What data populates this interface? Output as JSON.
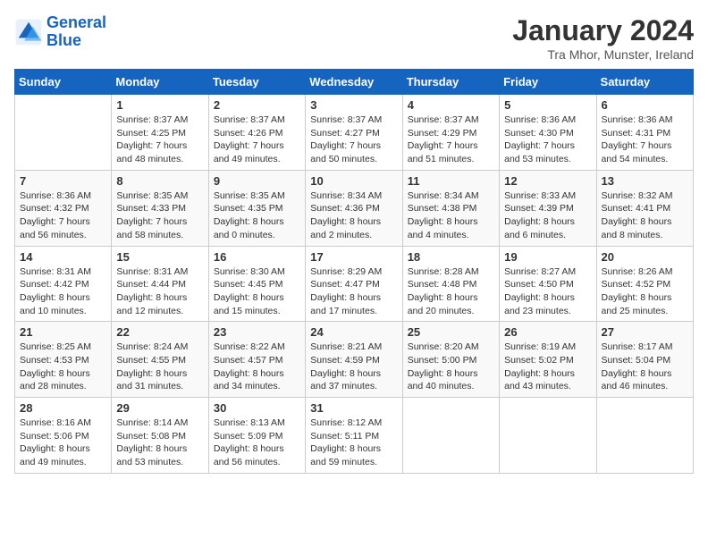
{
  "header": {
    "logo_line1": "General",
    "logo_line2": "Blue",
    "title": "January 2024",
    "subtitle": "Tra Mhor, Munster, Ireland"
  },
  "days_of_week": [
    "Sunday",
    "Monday",
    "Tuesday",
    "Wednesday",
    "Thursday",
    "Friday",
    "Saturday"
  ],
  "weeks": [
    [
      {
        "day": "",
        "info": ""
      },
      {
        "day": "1",
        "info": "Sunrise: 8:37 AM\nSunset: 4:25 PM\nDaylight: 7 hours\nand 48 minutes."
      },
      {
        "day": "2",
        "info": "Sunrise: 8:37 AM\nSunset: 4:26 PM\nDaylight: 7 hours\nand 49 minutes."
      },
      {
        "day": "3",
        "info": "Sunrise: 8:37 AM\nSunset: 4:27 PM\nDaylight: 7 hours\nand 50 minutes."
      },
      {
        "day": "4",
        "info": "Sunrise: 8:37 AM\nSunset: 4:29 PM\nDaylight: 7 hours\nand 51 minutes."
      },
      {
        "day": "5",
        "info": "Sunrise: 8:36 AM\nSunset: 4:30 PM\nDaylight: 7 hours\nand 53 minutes."
      },
      {
        "day": "6",
        "info": "Sunrise: 8:36 AM\nSunset: 4:31 PM\nDaylight: 7 hours\nand 54 minutes."
      }
    ],
    [
      {
        "day": "7",
        "info": "Sunrise: 8:36 AM\nSunset: 4:32 PM\nDaylight: 7 hours\nand 56 minutes."
      },
      {
        "day": "8",
        "info": "Sunrise: 8:35 AM\nSunset: 4:33 PM\nDaylight: 7 hours\nand 58 minutes."
      },
      {
        "day": "9",
        "info": "Sunrise: 8:35 AM\nSunset: 4:35 PM\nDaylight: 8 hours\nand 0 minutes."
      },
      {
        "day": "10",
        "info": "Sunrise: 8:34 AM\nSunset: 4:36 PM\nDaylight: 8 hours\nand 2 minutes."
      },
      {
        "day": "11",
        "info": "Sunrise: 8:34 AM\nSunset: 4:38 PM\nDaylight: 8 hours\nand 4 minutes."
      },
      {
        "day": "12",
        "info": "Sunrise: 8:33 AM\nSunset: 4:39 PM\nDaylight: 8 hours\nand 6 minutes."
      },
      {
        "day": "13",
        "info": "Sunrise: 8:32 AM\nSunset: 4:41 PM\nDaylight: 8 hours\nand 8 minutes."
      }
    ],
    [
      {
        "day": "14",
        "info": "Sunrise: 8:31 AM\nSunset: 4:42 PM\nDaylight: 8 hours\nand 10 minutes."
      },
      {
        "day": "15",
        "info": "Sunrise: 8:31 AM\nSunset: 4:44 PM\nDaylight: 8 hours\nand 12 minutes."
      },
      {
        "day": "16",
        "info": "Sunrise: 8:30 AM\nSunset: 4:45 PM\nDaylight: 8 hours\nand 15 minutes."
      },
      {
        "day": "17",
        "info": "Sunrise: 8:29 AM\nSunset: 4:47 PM\nDaylight: 8 hours\nand 17 minutes."
      },
      {
        "day": "18",
        "info": "Sunrise: 8:28 AM\nSunset: 4:48 PM\nDaylight: 8 hours\nand 20 minutes."
      },
      {
        "day": "19",
        "info": "Sunrise: 8:27 AM\nSunset: 4:50 PM\nDaylight: 8 hours\nand 23 minutes."
      },
      {
        "day": "20",
        "info": "Sunrise: 8:26 AM\nSunset: 4:52 PM\nDaylight: 8 hours\nand 25 minutes."
      }
    ],
    [
      {
        "day": "21",
        "info": "Sunrise: 8:25 AM\nSunset: 4:53 PM\nDaylight: 8 hours\nand 28 minutes."
      },
      {
        "day": "22",
        "info": "Sunrise: 8:24 AM\nSunset: 4:55 PM\nDaylight: 8 hours\nand 31 minutes."
      },
      {
        "day": "23",
        "info": "Sunrise: 8:22 AM\nSunset: 4:57 PM\nDaylight: 8 hours\nand 34 minutes."
      },
      {
        "day": "24",
        "info": "Sunrise: 8:21 AM\nSunset: 4:59 PM\nDaylight: 8 hours\nand 37 minutes."
      },
      {
        "day": "25",
        "info": "Sunrise: 8:20 AM\nSunset: 5:00 PM\nDaylight: 8 hours\nand 40 minutes."
      },
      {
        "day": "26",
        "info": "Sunrise: 8:19 AM\nSunset: 5:02 PM\nDaylight: 8 hours\nand 43 minutes."
      },
      {
        "day": "27",
        "info": "Sunrise: 8:17 AM\nSunset: 5:04 PM\nDaylight: 8 hours\nand 46 minutes."
      }
    ],
    [
      {
        "day": "28",
        "info": "Sunrise: 8:16 AM\nSunset: 5:06 PM\nDaylight: 8 hours\nand 49 minutes."
      },
      {
        "day": "29",
        "info": "Sunrise: 8:14 AM\nSunset: 5:08 PM\nDaylight: 8 hours\nand 53 minutes."
      },
      {
        "day": "30",
        "info": "Sunrise: 8:13 AM\nSunset: 5:09 PM\nDaylight: 8 hours\nand 56 minutes."
      },
      {
        "day": "31",
        "info": "Sunrise: 8:12 AM\nSunset: 5:11 PM\nDaylight: 8 hours\nand 59 minutes."
      },
      {
        "day": "",
        "info": ""
      },
      {
        "day": "",
        "info": ""
      },
      {
        "day": "",
        "info": ""
      }
    ]
  ]
}
